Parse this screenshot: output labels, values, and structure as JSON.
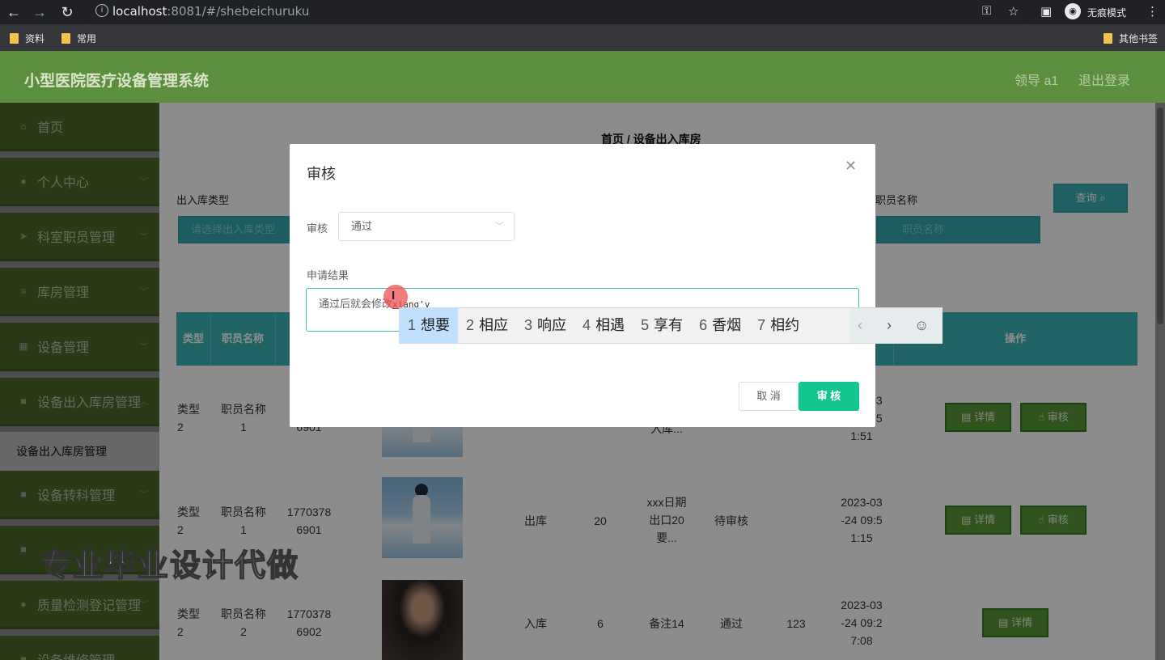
{
  "browser": {
    "url_host": "localhost",
    "url_rest": ":8081/#/shebeichuruku",
    "incognito_label": "无痕模式",
    "bookmarks": [
      "资料",
      "常用"
    ],
    "other_bookmarks": "其他书签"
  },
  "header": {
    "title": "小型医院医疗设备管理系统",
    "user": "领导 a1",
    "logout": "退出登录"
  },
  "sidebar": {
    "items": [
      {
        "label": "首页",
        "icon": "home-icon"
      },
      {
        "label": "个人中心",
        "icon": "user-icon"
      },
      {
        "label": "科室职员管理",
        "icon": "send-icon"
      },
      {
        "label": "库房管理",
        "icon": "list-icon"
      },
      {
        "label": "设备管理",
        "icon": "grid-icon"
      },
      {
        "label": "设备出入库房管理",
        "icon": "folder-icon"
      },
      {
        "label": "设备转科管理",
        "icon": "folder-icon"
      },
      {
        "label": "质量检测登记管理",
        "icon": "user-icon"
      },
      {
        "label": "设备维修管理",
        "icon": "folder-icon"
      }
    ],
    "active_sub": "设备出入库房管理"
  },
  "main": {
    "breadcrumb": "首页 / 设备出入库房",
    "filter_type_label": "出入库类型",
    "filter_type_placeholder": "请选择出入库类型",
    "filter_staff_label": "职员名称",
    "filter_staff_placeholder": "职员名称",
    "query_button": "查询",
    "columns": {
      "type": "类型",
      "staff": "职员名称",
      "ops": "操作"
    },
    "rows": [
      {
        "type": "类型\n2",
        "staff": "职员名称\n1",
        "phone": "1\n6901",
        "remark": "入库...",
        "time": "2023-03\n-24 09:5\n1:51"
      },
      {
        "type": "类型\n2",
        "staff": "职员名称\n1",
        "phone": "1770378\n6901",
        "inout": "出库",
        "qty": "20",
        "remark": "xxx日期\n出口20\n要...",
        "status": "待审核",
        "time": "2023-03\n-24 09:5\n1:15"
      },
      {
        "type": "类型\n2",
        "staff": "职员名称\n2",
        "phone": "1770378\n6902",
        "inout": "入库",
        "qty": "6",
        "remark": "备注14",
        "status": "通过",
        "result": "123",
        "time": "2023-03\n-24 09:2\n7:08"
      }
    ],
    "detail_button": "详情",
    "audit_button": "审核"
  },
  "dialog": {
    "title": "审核",
    "audit_label": "审核",
    "audit_value": "通过",
    "result_label": "申请结果",
    "result_text": "通过后就会修改",
    "pinyin": "xiang'y",
    "cancel": "取 消",
    "confirm": "审 核"
  },
  "ime": {
    "candidates": [
      {
        "n": "1",
        "word": "想要"
      },
      {
        "n": "2",
        "word": "相应"
      },
      {
        "n": "3",
        "word": "响应"
      },
      {
        "n": "4",
        "word": "相遇"
      },
      {
        "n": "5",
        "word": "享有"
      },
      {
        "n": "6",
        "word": "香烟"
      },
      {
        "n": "7",
        "word": "相约"
      }
    ]
  },
  "watermark": "专业毕业设计代做",
  "colors": {
    "sidebar": "#4d6b2b",
    "header": "#5b8f3f",
    "accent_teal": "#3fb6bb",
    "confirm_green": "#13c58e"
  }
}
